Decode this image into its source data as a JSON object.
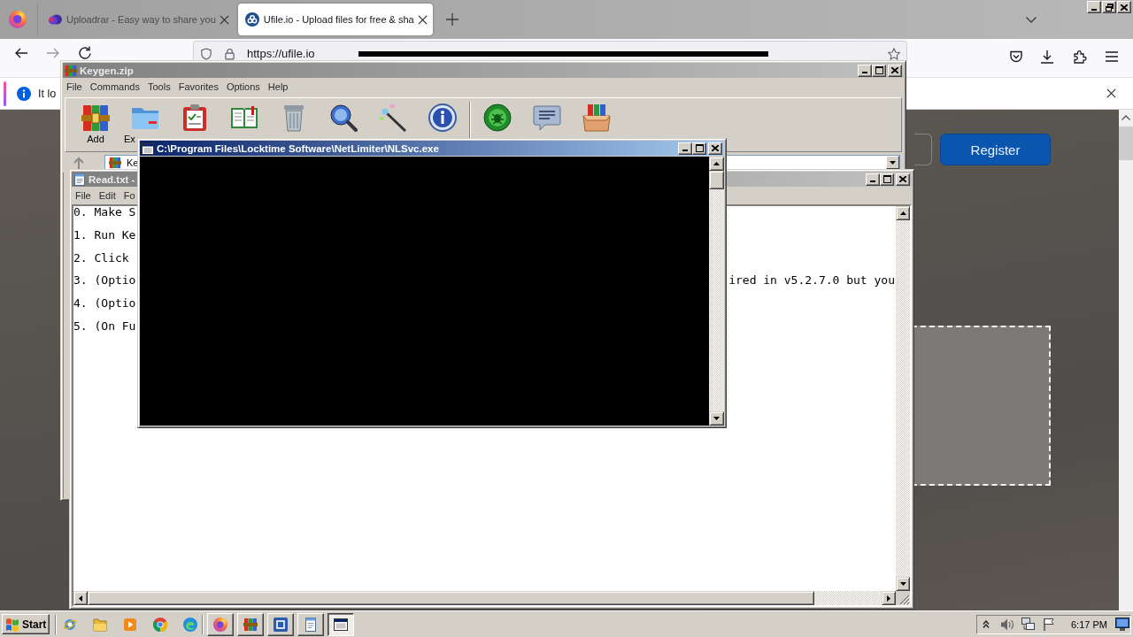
{
  "browser": {
    "tabs": [
      {
        "title": "Uploadrar - Easy way to share you",
        "selected": false
      },
      {
        "title": "Ufile.io - Upload files for free & sha",
        "selected": true
      }
    ],
    "address_bar": {
      "url": "https://ufile.io"
    },
    "notification": {
      "text": "It lo"
    },
    "page": {
      "register_button": "Register"
    }
  },
  "archive_window": {
    "title": "Keygen.zip",
    "active": false,
    "menu": [
      "File",
      "Commands",
      "Tools",
      "Favorites",
      "Options",
      "Help"
    ],
    "toolbar": [
      "Add",
      "Ex"
    ],
    "path": "Ke"
  },
  "notepad_window": {
    "title": "Read.txt -",
    "active": false,
    "menu": [
      "File",
      "Edit",
      "Fo"
    ],
    "lines": [
      {
        "text": "0. Make S"
      },
      {
        "text": "1. Run Ke"
      },
      {
        "text": "2. Click"
      },
      {
        "text": "3. (Optio",
        "tail": "ired in v5.2.7.0 but you"
      },
      {
        "text": "4. (Optio"
      },
      {
        "text": "5. (On Fu"
      }
    ]
  },
  "console_window": {
    "title": "C:\\Program Files\\Locktime Software\\NetLimiter\\NLSvc.exe",
    "active": true
  },
  "taskbar": {
    "start": "Start",
    "tasks": [
      {
        "kind": "browser",
        "selected": false
      },
      {
        "kind": "archive",
        "selected": false
      },
      {
        "kind": "app",
        "selected": false
      },
      {
        "kind": "notepad",
        "selected": false
      },
      {
        "kind": "console",
        "selected": true
      }
    ],
    "clock": "6:17 PM"
  }
}
